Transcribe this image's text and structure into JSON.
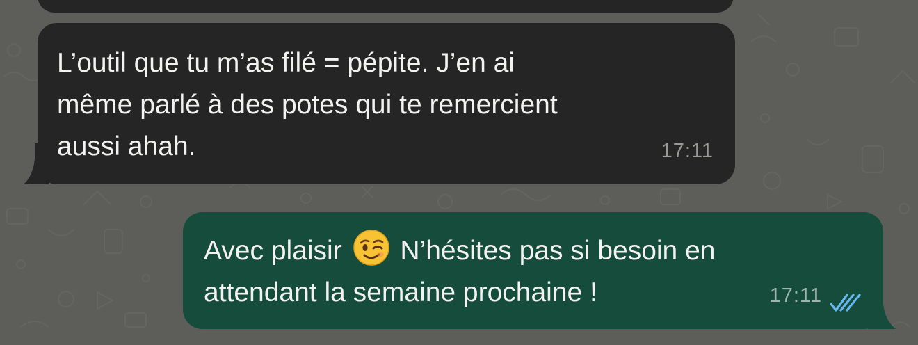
{
  "conversation": {
    "previous_message": {
      "text": ""
    },
    "messages": [
      {
        "direction": "incoming",
        "text": "L’outil que tu m’as filé = pépite. J’en ai\nmême parlé à des potes qui te remercient\naussi ahah.",
        "time": "17:11"
      },
      {
        "direction": "outgoing",
        "text_before_emoji": "Avec plaisir ",
        "emoji": "winking-face",
        "text_after_emoji": " N’hésites pas si besoin en\nattendant la semaine prochaine !",
        "time": "17:11",
        "status": "read"
      }
    ]
  },
  "colors": {
    "background": "#5d5e5a",
    "incoming_bubble": "#252525",
    "outgoing_bubble": "#154c3b",
    "text": "#f2f2f0",
    "read_ticks": "#66b8ee"
  }
}
